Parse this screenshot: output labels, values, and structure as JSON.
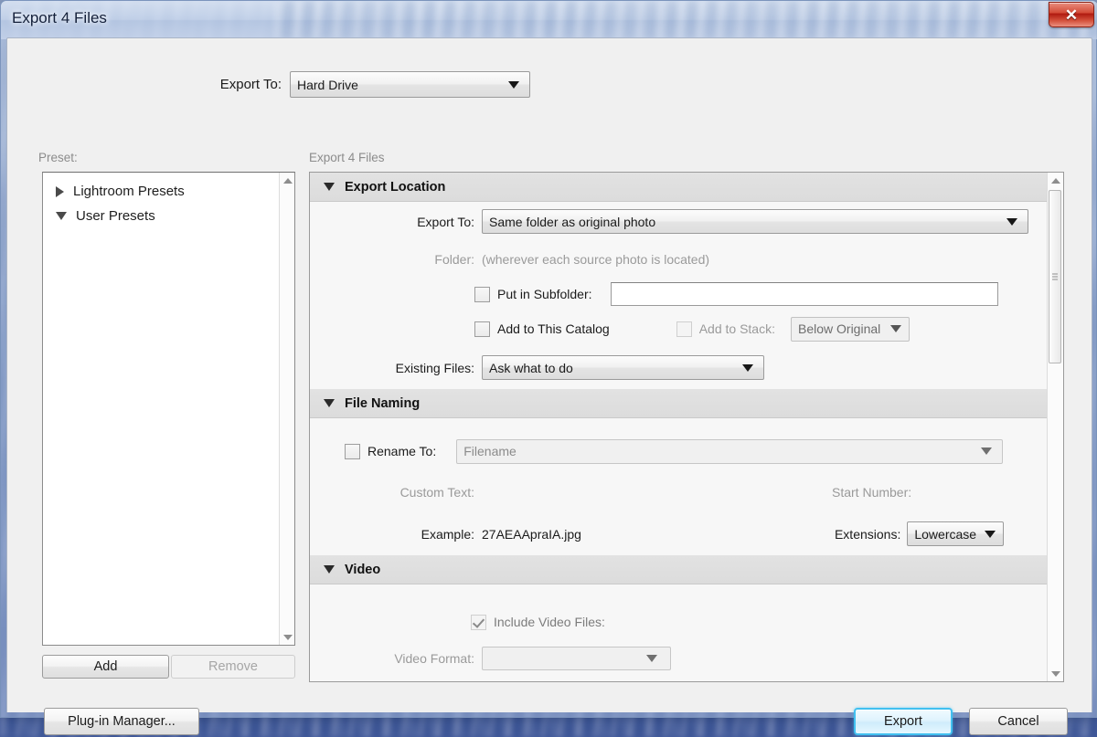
{
  "window": {
    "title": "Export 4 Files",
    "close_icon": "close-icon",
    "close_glyph": "✕"
  },
  "top": {
    "export_to_label": "Export To:",
    "export_to_value": "Hard Drive"
  },
  "captions": {
    "preset": "Preset:",
    "main": "Export 4 Files"
  },
  "preset_panel": {
    "items": [
      {
        "label": "Lightroom Presets",
        "expanded": false
      },
      {
        "label": "User Presets",
        "expanded": true
      }
    ],
    "add_label": "Add",
    "remove_label": "Remove"
  },
  "sections": {
    "export_location": {
      "title": "Export Location",
      "export_to_label": "Export To:",
      "export_to_value": "Same folder as original photo",
      "folder_label": "Folder:",
      "folder_value": "(wherever each source photo is located)",
      "put_in_subfolder_label": "Put in Subfolder:",
      "put_in_subfolder_value": "",
      "put_in_subfolder_checked": false,
      "add_to_catalog_label": "Add to This Catalog",
      "add_to_catalog_checked": false,
      "add_to_stack_label": "Add to Stack:",
      "add_to_stack_checked": false,
      "stack_position_value": "Below Original",
      "existing_files_label": "Existing Files:",
      "existing_files_value": "Ask what to do"
    },
    "file_naming": {
      "title": "File Naming",
      "rename_to_label": "Rename To:",
      "rename_to_checked": false,
      "rename_to_value": "Filename",
      "custom_text_label": "Custom Text:",
      "start_number_label": "Start Number:",
      "example_label": "Example:",
      "example_value": "27AEAApraIA.jpg",
      "extensions_label": "Extensions:",
      "extensions_value": "Lowercase"
    },
    "video": {
      "title": "Video",
      "include_video_label": "Include Video Files:",
      "include_video_checked": true,
      "video_format_label": "Video Format:",
      "video_format_value": ""
    }
  },
  "footer": {
    "plugin_manager_label": "Plug-in Manager...",
    "export_label": "Export",
    "cancel_label": "Cancel"
  },
  "colors": {
    "accent": "#41c0f0",
    "close_red": "#b01b10",
    "section_header_bg": "#dcdcdc",
    "dialog_bg": "#f0f0f0"
  }
}
